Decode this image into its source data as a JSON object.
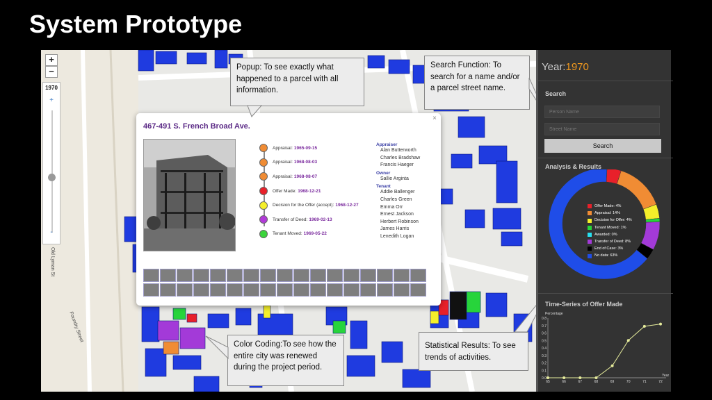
{
  "slide_title": "System Prototype",
  "map": {
    "zoom_in": "+",
    "zoom_out": "−",
    "year_slider": {
      "value": "1970",
      "plus": "+",
      "minus": "-",
      "position": 0.55
    },
    "road_labels": [
      "Old Lyman St",
      "Foundry Street"
    ]
  },
  "popup": {
    "close": "×",
    "title": "467-491 S. French Broad Ave.",
    "timeline": [
      {
        "label": "Appraisal:",
        "date": "1965-09-15",
        "color": "#f08c34"
      },
      {
        "label": "Appraisal:",
        "date": "1968-08-03",
        "color": "#f08c34"
      },
      {
        "label": "Appraisal:",
        "date": "1968-08-07",
        "color": "#f08c34"
      },
      {
        "label": "Offer Made:",
        "date": "1968-12-21",
        "color": "#e8202a"
      },
      {
        "label": "Decision for the Offer (accept):",
        "date": "1968-12-27",
        "color": "#f5ef2a"
      },
      {
        "label": "Transfer of Deed:",
        "date": "1969-02-13",
        "color": "#b13ad8"
      },
      {
        "label": "Tenant Moved:",
        "date": "1969-05-22",
        "color": "#3bd43b"
      }
    ],
    "appraiser_heading": "Appraiser",
    "appraisers": [
      "Alan Butterworth",
      "Charles Bradshaw",
      "Francis Haeger"
    ],
    "owner_heading": "Owner",
    "owners": [
      "Sallie Arginta"
    ],
    "tenant_heading": "Tenant",
    "tenants": [
      "Addie Ballenger",
      "Charles Green",
      "Emma Orr",
      "Ernest Jackson",
      "Herbert Robinson",
      "James Harris",
      "Lenedith Logan"
    ]
  },
  "callouts": {
    "popup": "Popup: To see exactly what happened to a parcel with all information.",
    "search": "Search Function: To search for a name and/or a parcel street name.",
    "color": "Color Coding:To see how the entire city was renewed during the project period.",
    "stats": "Statistical Results: To see trends of activities."
  },
  "panel": {
    "year_label": "Year:",
    "year_value": "1970",
    "search_heading": "Search",
    "person_placeholder": "Person Name",
    "street_placeholder": "Street Name",
    "search_button": "Search",
    "analysis_heading": "Analysis & Results",
    "timeseries_heading": "Time-Series of Offer Made",
    "y_axis_label": "Percentage",
    "x_axis_label": "Year"
  },
  "chart_data": [
    {
      "type": "pie",
      "title": "Analysis & Results",
      "labels": [
        "Offer Made: 4%",
        "Appraisal: 14%",
        "Decision for Offer: 4%",
        "Tenant Moved: 1%",
        "Awarded: 0%",
        "Transfer of Deed: 8%",
        "End of Case: 3%",
        "No data: 63%"
      ],
      "values": [
        4,
        14,
        4,
        1,
        0,
        8,
        3,
        63
      ],
      "colors": [
        "#e8202a",
        "#f08c34",
        "#f5ef2a",
        "#27d43b",
        "#27e0f0",
        "#a33ad8",
        "#000000",
        "#1f4de8"
      ]
    },
    {
      "type": "line",
      "title": "Time-Series of Offer Made",
      "xlabel": "Year",
      "ylabel": "Percentage",
      "x": [
        65,
        66,
        67,
        68,
        69,
        70,
        71,
        72
      ],
      "y": [
        0.0,
        0.0,
        0.0,
        0.0,
        0.16,
        0.5,
        0.69,
        0.72
      ],
      "ylim": [
        0.0,
        0.8
      ],
      "yticks": [
        "0.0",
        "0.1",
        "0.2",
        "0.3",
        "0.4",
        "0.5",
        "0.6",
        "0.7",
        "0.8"
      ],
      "color": "#e6ec9c",
      "grid": false
    }
  ]
}
